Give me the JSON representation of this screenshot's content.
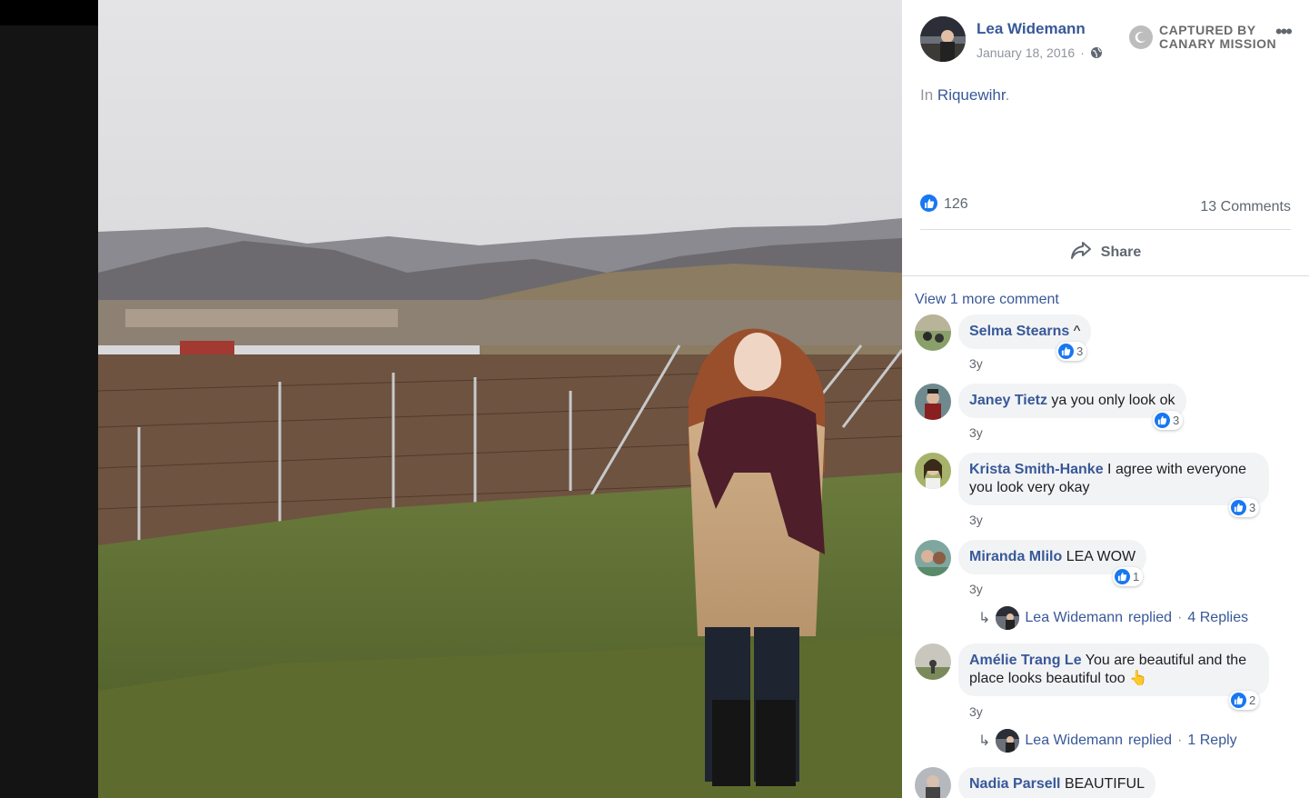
{
  "post": {
    "author": "Lea Widemann",
    "date": "January 18, 2016",
    "date_separator": "·",
    "captured_line1": "CAPTURED BY",
    "captured_line2": "CANARY MISSION",
    "more_icon": "more-horizontal-icon",
    "location_prefix": "In",
    "location": "Riquewihr",
    "location_suffix": "."
  },
  "engagement": {
    "like_count": "126",
    "comments_label": "13 Comments",
    "share_label": "Share"
  },
  "comments": {
    "view_more": "View 1 more comment",
    "items": [
      {
        "name": "Selma Stearns",
        "text": "^",
        "likes": "3",
        "time": "3y"
      },
      {
        "name": "Janey Tietz",
        "text": "ya you only look ok",
        "likes": "3",
        "time": "3y"
      },
      {
        "name": "Krista Smith-Hanke",
        "text": "I agree with everyone",
        "text2": "you look very okay",
        "likes": "3",
        "time": "3y"
      },
      {
        "name": "Miranda Mlilo",
        "text": "LEA WOW",
        "likes": "1",
        "time": "3y"
      },
      {
        "name": "Amélie Trang Le",
        "text": "You are beautiful and the",
        "text2": "place looks beautiful too",
        "emoji": "👆",
        "likes": "2",
        "time": "3y"
      },
      {
        "name": "Nadia Parsell",
        "text": "BEAUTIFUL",
        "likes": "",
        "time": ""
      }
    ],
    "replies": [
      {
        "author": "Lea Widemann",
        "verb": "replied",
        "sep": "·",
        "count": "4 Replies"
      },
      {
        "author": "Lea Widemann",
        "verb": "replied",
        "sep": "·",
        "count": "1 Reply"
      }
    ]
  },
  "colors": {
    "link": "#385898",
    "like_blue": "#1877f2",
    "bubble_bg": "#f2f3f5",
    "muted": "#90949c"
  }
}
